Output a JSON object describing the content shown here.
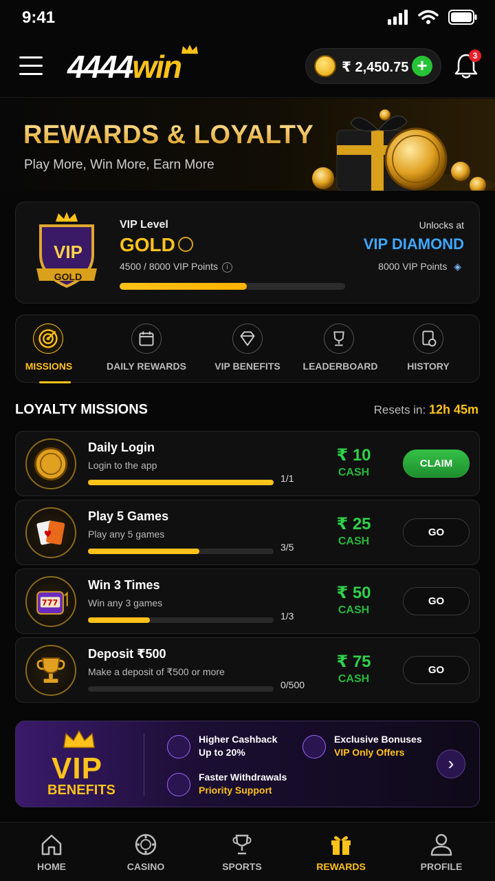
{
  "status_bar": {
    "time": "9:41"
  },
  "header": {
    "logo_num": "4444",
    "logo_win": "win",
    "wallet_amount": "₹ 2,450.75",
    "wallet_add": "+",
    "notification_count": "3"
  },
  "hero": {
    "title": "REWARDS & LOYALTY",
    "subtitle": "Play More, Win More, Earn More"
  },
  "vip": {
    "badge_top": "VIP",
    "badge_bottom": "GOLD",
    "level_label": "VIP Level",
    "level": "GOLD",
    "points_text": "4500 / 8000 VIP Points",
    "progress": 0.5625,
    "unlocks_label": "Unlocks at",
    "unlocks_level": "VIP DIAMOND",
    "unlocks_points": "8000 VIP Points"
  },
  "tabs": [
    {
      "label": "MISSIONS",
      "icon": "target-icon",
      "active": true
    },
    {
      "label": "DAILY REWARDS",
      "icon": "calendar-icon",
      "active": false
    },
    {
      "label": "VIP BENEFITS",
      "icon": "diamond-icon",
      "active": false
    },
    {
      "label": "LEADERBOARD",
      "icon": "trophy-icon",
      "active": false
    },
    {
      "label": "HISTORY",
      "icon": "history-icon",
      "active": false
    }
  ],
  "missions_section": {
    "title": "LOYALTY MISSIONS",
    "resets_label": "Resets in:",
    "resets_value": "12h 45m"
  },
  "missions": [
    {
      "title": "Daily Login",
      "desc": "Login to the app",
      "progress_text": "1/1",
      "progress": 1.0,
      "reward": "₹ 10",
      "unit": "CASH",
      "button": "CLAIM",
      "icon": "coin-icon"
    },
    {
      "title": "Play 5 Games",
      "desc": "Play any 5 games",
      "progress_text": "3/5",
      "progress": 0.6,
      "reward": "₹ 25",
      "unit": "CASH",
      "button": "GO",
      "icon": "cards-icon"
    },
    {
      "title": "Win 3 Times",
      "desc": "Win any 3 games",
      "progress_text": "1/3",
      "progress": 0.333,
      "reward": "₹ 50",
      "unit": "CASH",
      "button": "GO",
      "icon": "slot-machine-icon"
    },
    {
      "title": "Deposit ₹500",
      "desc": "Make a deposit of ₹500 or more",
      "progress_text": "0/500",
      "progress": 0.0,
      "reward": "₹ 75",
      "unit": "CASH",
      "button": "GO",
      "icon": "trophy-icon"
    }
  ],
  "benefits": {
    "vip": "VIP",
    "label": "BENEFITS",
    "items": [
      {
        "line1": "Higher Cashback",
        "line2": "Up to 20%"
      },
      {
        "line1": "Exclusive Bonuses",
        "line2": "VIP Only Offers"
      },
      {
        "line1": "Faster Withdrawals",
        "line2": "Priority Support"
      }
    ],
    "arrow": "›"
  },
  "bottom_nav": [
    {
      "label": "HOME",
      "icon": "home-icon",
      "active": false
    },
    {
      "label": "CASINO",
      "icon": "casino-chip-icon",
      "active": false
    },
    {
      "label": "SPORTS",
      "icon": "trophy-icon",
      "active": false
    },
    {
      "label": "REWARDS",
      "icon": "gift-icon",
      "active": true
    },
    {
      "label": "PROFILE",
      "icon": "user-icon",
      "active": false
    }
  ]
}
